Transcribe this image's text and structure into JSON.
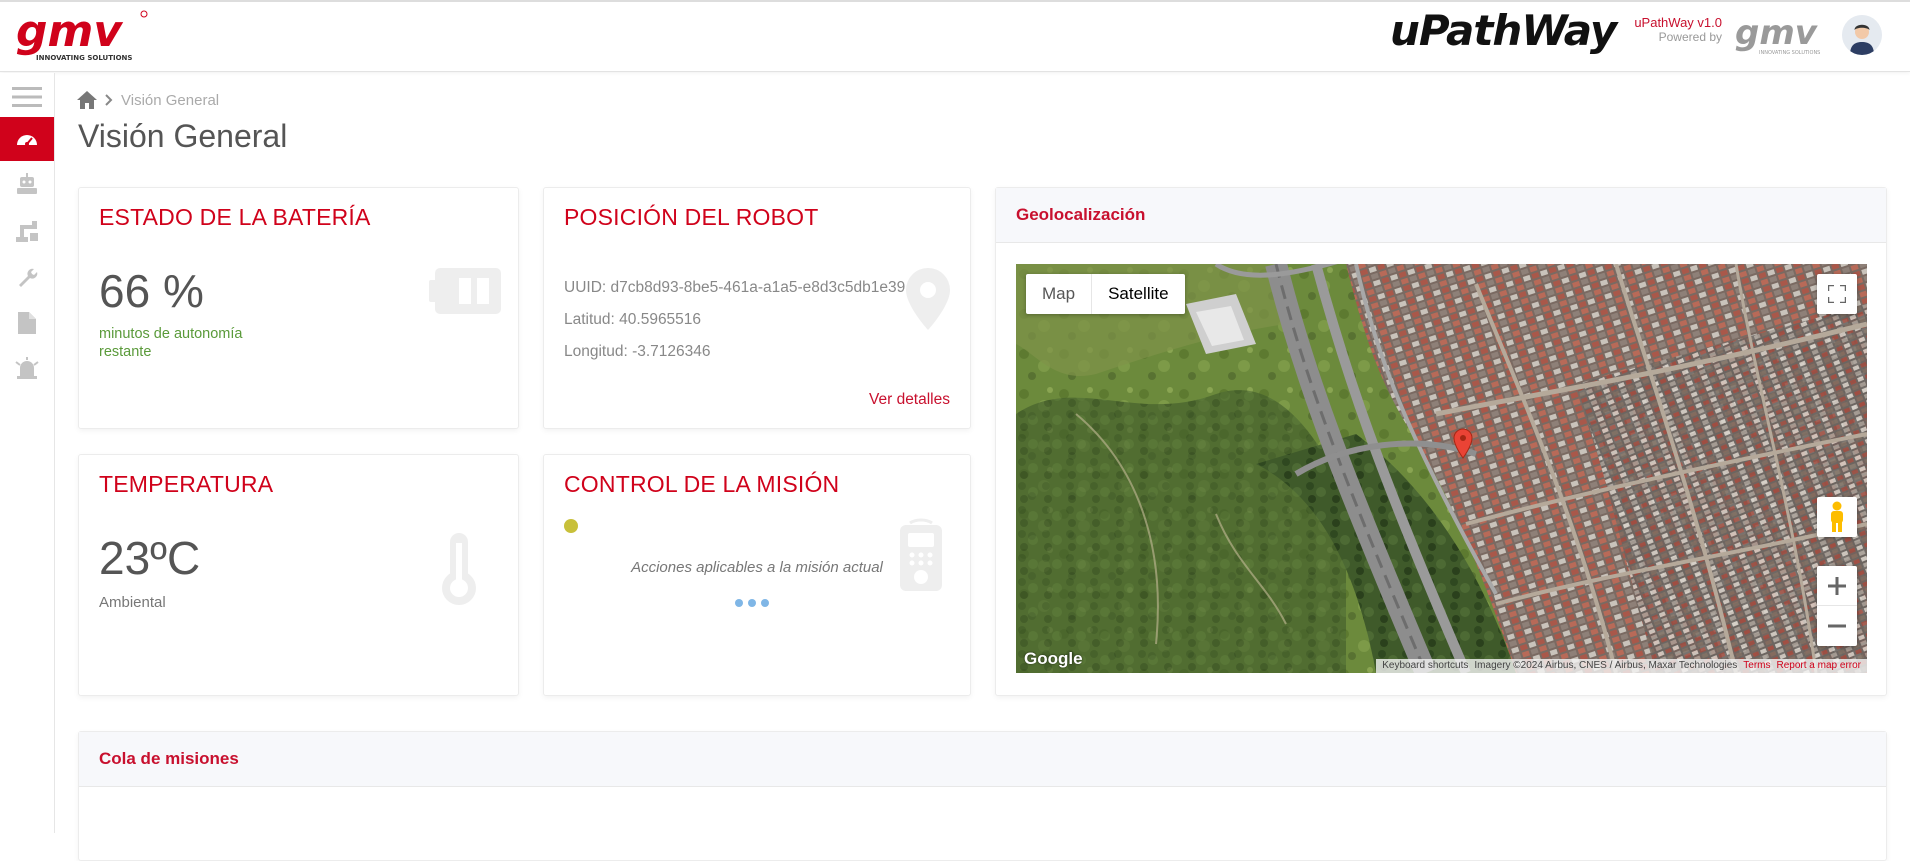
{
  "header": {
    "brand_logo_text": "gmv",
    "brand_logo_tagline": "INNOVATING SOLUTIONS",
    "app_title": "uPathWay",
    "version": "uPathWay v1.0",
    "powered_by": "Powered by",
    "accent_color": "#d0021b"
  },
  "sidebar": {
    "items": [
      {
        "icon": "menu-icon"
      },
      {
        "icon": "dashboard-icon",
        "active": true
      },
      {
        "icon": "robot-icon"
      },
      {
        "icon": "robot-arm-icon"
      },
      {
        "icon": "wrench-icon"
      },
      {
        "icon": "document-icon"
      },
      {
        "icon": "alarm-icon"
      }
    ]
  },
  "breadcrumb": {
    "current": "Visión General"
  },
  "page": {
    "title": "Visión General"
  },
  "battery": {
    "title": "ESTADO DE LA BATERÍA",
    "value": "66 %",
    "subtitle": "minutos de autonomía restante"
  },
  "position": {
    "title": "POSICIÓN DEL ROBOT",
    "uuid": "UUID: d7cb8d93-8be5-461a-a1a5-e8d3c5db1e39",
    "latitude": "Latitud: 40.5965516",
    "longitude": "Longitud: -3.7126346",
    "details_link": "Ver detalles"
  },
  "temperature": {
    "title": "TEMPERATURA",
    "value": "23ºC",
    "subtitle": "Ambiental"
  },
  "mission_control": {
    "title": "CONTROL DE LA MISIÓN",
    "status_color": "#c8c03a",
    "message": "Acciones aplicables a la misión actual"
  },
  "geolocation": {
    "title": "Geolocalización",
    "map_types": [
      "Map",
      "Satellite"
    ],
    "selected_map_type": "Satellite",
    "google_label": "Google",
    "attribution": {
      "shortcuts": "Keyboard shortcuts",
      "imagery": "Imagery ©2024 Airbus, CNES / Airbus, Maxar Technologies",
      "terms": "Terms",
      "report": "Report a map error"
    }
  },
  "mission_queue": {
    "title": "Cola de misiones"
  }
}
